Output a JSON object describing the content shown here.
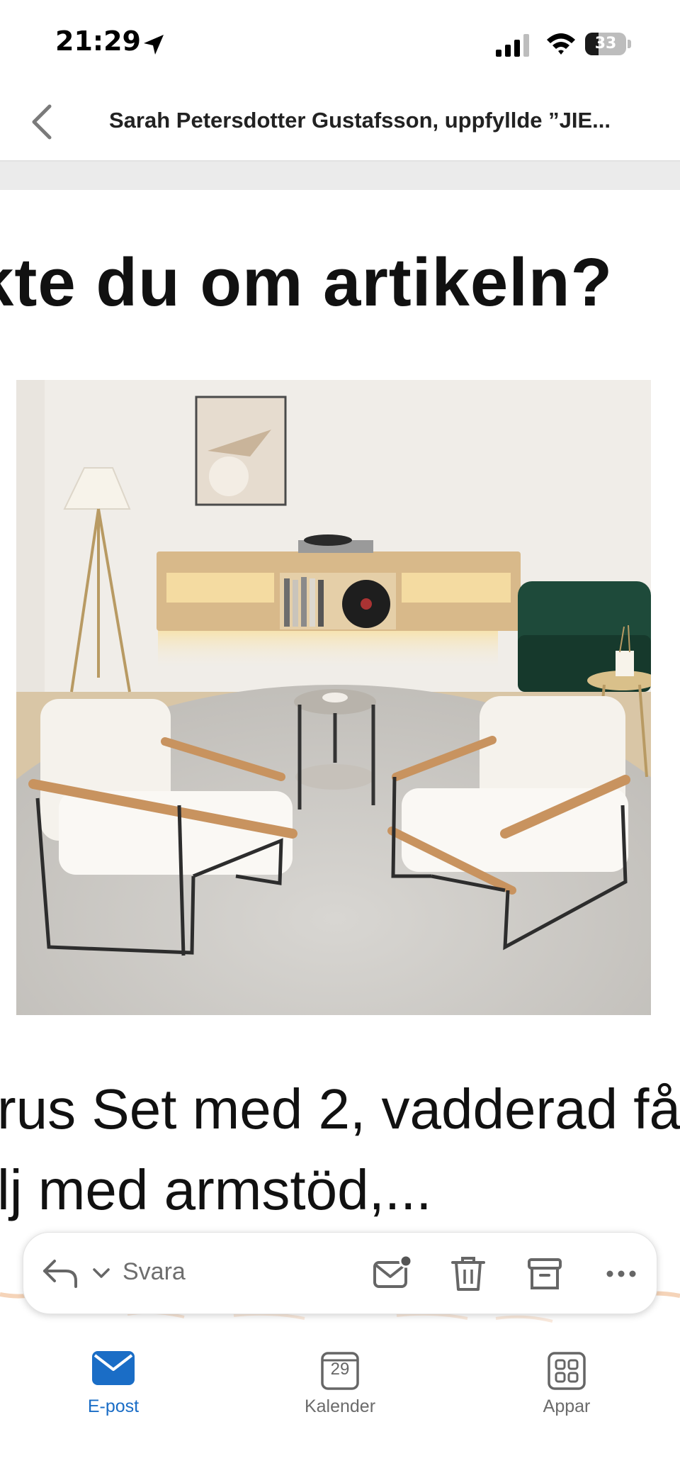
{
  "status_bar": {
    "time": "21:29",
    "battery_level": "33",
    "battery_fraction": 0.33
  },
  "header": {
    "title": "Sarah Petersdotter Gustafsson, uppfyllde ”JIE..."
  },
  "email": {
    "headline": "kte du om artikeln?",
    "product_title_lines": [
      "rus Set med 2, vadderad få",
      "lj med armstöd,..."
    ]
  },
  "action_bar": {
    "reply_label": "Svara"
  },
  "tabs": [
    {
      "label": "E-post",
      "icon": "mail-icon",
      "active": true
    },
    {
      "label": "Kalender",
      "icon": "calendar-icon",
      "day": "29",
      "active": false
    },
    {
      "label": "Appar",
      "icon": "apps-grid-icon",
      "active": false
    }
  ],
  "colors": {
    "accent": "#1a6dc6",
    "tab_inactive": "#6b6b6b",
    "header_divider": "#e2e2e2"
  }
}
